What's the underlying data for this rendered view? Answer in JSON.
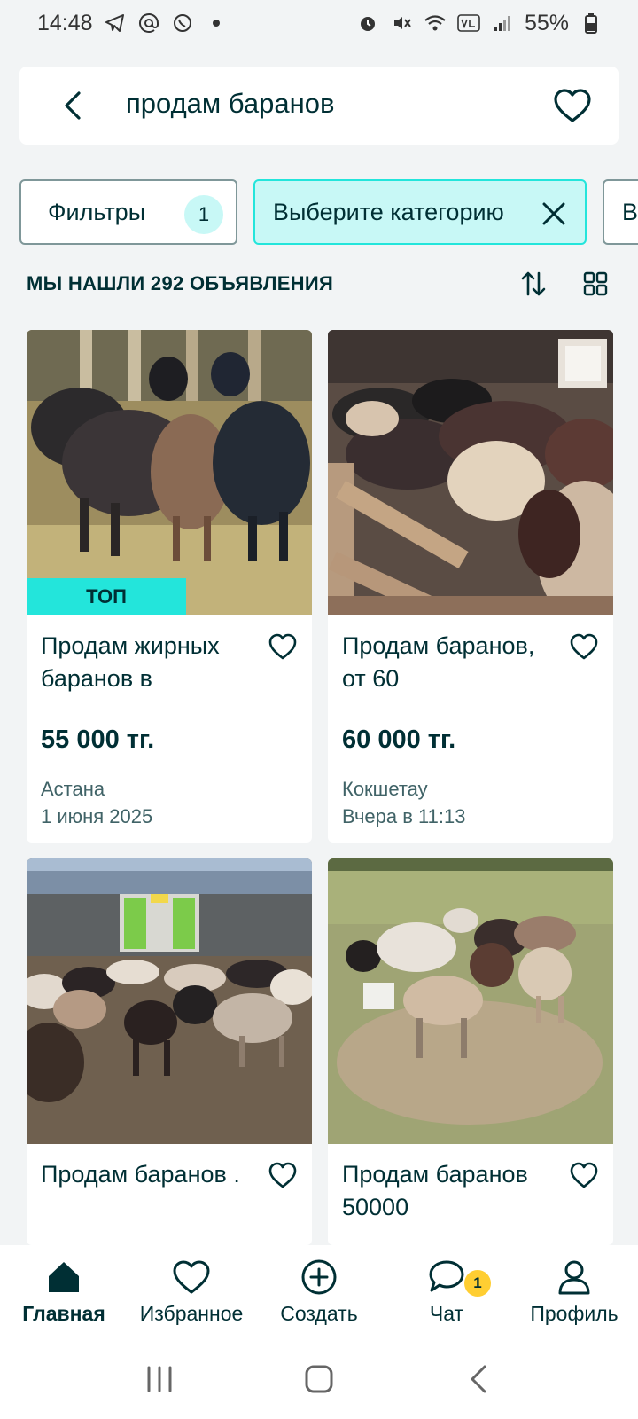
{
  "status_bar": {
    "time": "14:48",
    "battery": "55%",
    "left_icons": [
      "telegram-icon",
      "at-sign-icon",
      "whatsapp-icon",
      "dot-icon"
    ],
    "right_icons": [
      "alarm-icon",
      "mute-icon",
      "wifi-icon",
      "volte-icon",
      "signal-icon",
      "battery-icon"
    ]
  },
  "search": {
    "query": "продам баранов"
  },
  "chips": {
    "filters_label": "Фильтры",
    "filters_count": "1",
    "category_label": "Выберите категорию",
    "all_label": "Вся"
  },
  "results": {
    "count_text": "МЫ НАШЛИ 292 ОБЪЯВЛЕНИЯ"
  },
  "listings": [
    {
      "title": "Продам жирных баранов в",
      "price": "55 000 тг.",
      "city": "Астана",
      "date": "1 июня 2025",
      "badge": "ТОП"
    },
    {
      "title": "Продам баранов, от 60",
      "price": "60 000 тг.",
      "city": "Кокшетау",
      "date": "Вчера в 11:13"
    },
    {
      "title": "Продам баранов ."
    },
    {
      "title": "Продам баранов 50000"
    }
  ],
  "bottom_nav": [
    {
      "label": "Главная",
      "icon": "home-icon",
      "active": true
    },
    {
      "label": "Избранное",
      "icon": "heart-icon"
    },
    {
      "label": "Создать",
      "icon": "plus-circle-icon"
    },
    {
      "label": "Чат",
      "icon": "chat-icon",
      "badge": "1"
    },
    {
      "label": "Профиль",
      "icon": "profile-icon"
    }
  ],
  "colors": {
    "primary_text": "#002f34",
    "accent": "#23e5db",
    "accent_light": "#c8f8f6",
    "badge_yellow": "#ffce32",
    "background": "#f2f4f5"
  }
}
